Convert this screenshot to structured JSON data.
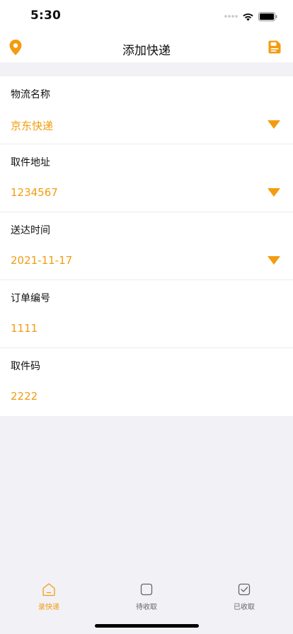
{
  "status": {
    "time": "5:30",
    "icons": [
      "cellular-dots-icon",
      "wifi-icon",
      "battery-icon"
    ]
  },
  "nav": {
    "title": "添加快递",
    "left_icon": "location-pin-icon",
    "right_icon": "save-note-icon"
  },
  "colors": {
    "accent": "#f39c0f",
    "background": "#f2f1f6",
    "card": "#ffffff",
    "text": "#111111"
  },
  "form": {
    "rows": [
      {
        "label": "物流名称",
        "value": "京东快递",
        "dropdown": true
      },
      {
        "label": "取件地址",
        "value": "1234567",
        "dropdown": true
      },
      {
        "label": "送达时间",
        "value": "2021-11-17",
        "dropdown": true
      },
      {
        "label": "订单编号",
        "value": "1111",
        "dropdown": false
      },
      {
        "label": "取件码",
        "value": "2222",
        "dropdown": false
      }
    ]
  },
  "tabs": [
    {
      "label": "录快递",
      "icon": "home-icon",
      "active": true
    },
    {
      "label": "待收取",
      "icon": "square-icon",
      "active": false
    },
    {
      "label": "已收取",
      "icon": "checkbox-icon",
      "active": false
    }
  ]
}
